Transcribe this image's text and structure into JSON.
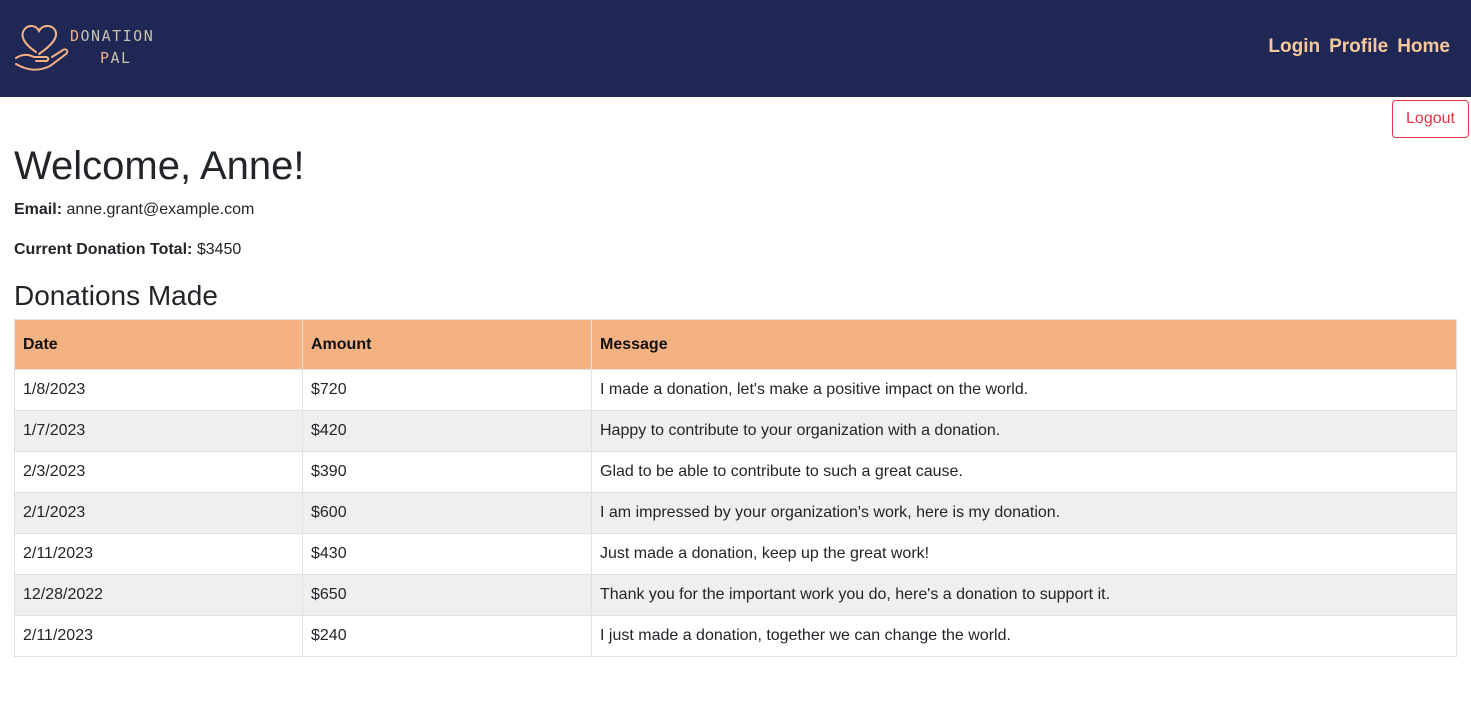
{
  "brand": {
    "line1_accent": "D",
    "line1_rest": "ONATION",
    "line2_accent": "P",
    "line2_rest": "AL",
    "logo_icon": "heart-hand-icon",
    "accent_color": "#f4b183",
    "navbar_color": "#1f2855"
  },
  "nav": {
    "login": "Login",
    "profile": "Profile",
    "home": "Home"
  },
  "logout_label": "Logout",
  "welcome": "Welcome, Anne!",
  "email": {
    "label": "Email:",
    "value": "anne.grant@example.com"
  },
  "total": {
    "label": "Current Donation Total:",
    "value": "$3450"
  },
  "section_title": "Donations Made",
  "table": {
    "headers": [
      "Date",
      "Amount",
      "Message"
    ],
    "header_color": "#f4b283",
    "rows": [
      {
        "date": "1/8/2023",
        "amount": "$720",
        "message": "I made a donation, let's make a positive impact on the world."
      },
      {
        "date": "1/7/2023",
        "amount": "$420",
        "message": "Happy to contribute to your organization with a donation."
      },
      {
        "date": "2/3/2023",
        "amount": "$390",
        "message": "Glad to be able to contribute to such a great cause."
      },
      {
        "date": "2/1/2023",
        "amount": "$600",
        "message": "I am impressed by your organization's work, here is my donation."
      },
      {
        "date": "2/11/2023",
        "amount": "$430",
        "message": "Just made a donation, keep up the great work!"
      },
      {
        "date": "12/28/2022",
        "amount": "$650",
        "message": "Thank you for the important work you do, here's a donation to support it."
      },
      {
        "date": "2/11/2023",
        "amount": "$240",
        "message": "I just made a donation, together we can change the world."
      }
    ]
  }
}
